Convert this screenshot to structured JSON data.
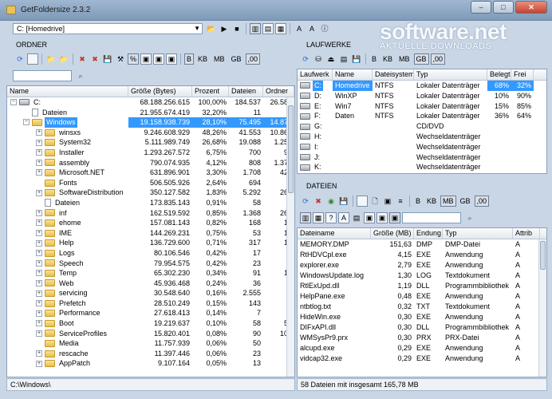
{
  "window": {
    "title": "GetFoldersize 2.3.2",
    "win_buttons": [
      "–",
      "□",
      "✕"
    ]
  },
  "watermark": {
    "main": "software.net",
    "sub": "AKTUELLE DOWNLOADS"
  },
  "toolbar": {
    "drive_path": "C: [Homedrive]",
    "unit_labels": [
      "B",
      "KB",
      "MB",
      "GB",
      ",00"
    ]
  },
  "left_panel": {
    "title": "ORDNER",
    "unit_labels": [
      "B",
      "KB",
      "MB",
      "GB",
      ",00"
    ],
    "columns": [
      "Name",
      "Größe (Bytes)",
      "Prozent",
      "Dateien",
      "Ordner"
    ],
    "rows": [
      {
        "name": "C:",
        "size": "68.188.256.615",
        "pct": "100,00%",
        "files": "184.537",
        "folders": "26.583",
        "level": 0,
        "kind": "drive",
        "exp": "−"
      },
      {
        "name": "Dateien",
        "size": "21.955.674.419",
        "pct": "32,20%",
        "files": "11",
        "folders": "",
        "level": 1,
        "kind": "file",
        "exp": ""
      },
      {
        "name": "Windows",
        "size": "19.158.938.739",
        "pct": "28,10%",
        "files": "75.495",
        "folders": "14.870",
        "level": 1,
        "kind": "folder",
        "exp": "−",
        "selected": true
      },
      {
        "name": "winsxs",
        "size": "9.246.608.929",
        "pct": "48,26%",
        "files": "41.553",
        "folders": "10.864",
        "level": 2,
        "kind": "folder",
        "exp": "+"
      },
      {
        "name": "System32",
        "size": "5.111.989.749",
        "pct": "26,68%",
        "files": "19.088",
        "folders": "1.250",
        "level": 2,
        "kind": "folder",
        "exp": "+"
      },
      {
        "name": "Installer",
        "size": "1.293.267.572",
        "pct": "6,75%",
        "files": "700",
        "folders": "90",
        "level": 2,
        "kind": "folder",
        "exp": "+"
      },
      {
        "name": "assembly",
        "size": "790.074.935",
        "pct": "4,12%",
        "files": "808",
        "folders": "1.372",
        "level": 2,
        "kind": "folder",
        "exp": "+"
      },
      {
        "name": "Microsoft.NET",
        "size": "631.896.901",
        "pct": "3,30%",
        "files": "1.708",
        "folders": "424",
        "level": 2,
        "kind": "folder",
        "exp": "+"
      },
      {
        "name": "Fonts",
        "size": "506.505.926",
        "pct": "2,64%",
        "files": "694",
        "folders": "0",
        "level": 2,
        "kind": "folder",
        "exp": ""
      },
      {
        "name": "SoftwareDistribution",
        "size": "350.127.582",
        "pct": "1,83%",
        "files": "5.292",
        "folders": "260",
        "level": 2,
        "kind": "folder",
        "exp": "+"
      },
      {
        "name": "Dateien",
        "size": "173.835.143",
        "pct": "0,91%",
        "files": "58",
        "folders": "",
        "level": 2,
        "kind": "file",
        "exp": ""
      },
      {
        "name": "inf",
        "size": "162.519.592",
        "pct": "0,85%",
        "files": "1.368",
        "folders": "268",
        "level": 2,
        "kind": "folder",
        "exp": "+"
      },
      {
        "name": "ehome",
        "size": "157.081.143",
        "pct": "0,82%",
        "files": "168",
        "folders": "17",
        "level": 2,
        "kind": "folder",
        "exp": "+"
      },
      {
        "name": "IME",
        "size": "144.269.231",
        "pct": "0,75%",
        "files": "53",
        "folders": "13",
        "level": 2,
        "kind": "folder",
        "exp": "+"
      },
      {
        "name": "Help",
        "size": "136.729.600",
        "pct": "0,71%",
        "files": "317",
        "folders": "13",
        "level": 2,
        "kind": "folder",
        "exp": "+"
      },
      {
        "name": "Logs",
        "size": "80.106.546",
        "pct": "0,42%",
        "files": "17",
        "folders": "3",
        "level": 2,
        "kind": "folder",
        "exp": "+"
      },
      {
        "name": "Speech",
        "size": "79.954.575",
        "pct": "0,42%",
        "files": "23",
        "folders": "7",
        "level": 2,
        "kind": "folder",
        "exp": "+"
      },
      {
        "name": "Temp",
        "size": "65.302.230",
        "pct": "0,34%",
        "files": "91",
        "folders": "13",
        "level": 2,
        "kind": "folder",
        "exp": "+"
      },
      {
        "name": "Web",
        "size": "45.936.468",
        "pct": "0,24%",
        "files": "36",
        "folders": "1",
        "level": 2,
        "kind": "folder",
        "exp": "+"
      },
      {
        "name": "servicing",
        "size": "30.548.640",
        "pct": "0,16%",
        "files": "2.555",
        "folders": "5",
        "level": 2,
        "kind": "folder",
        "exp": "+"
      },
      {
        "name": "Prefetch",
        "size": "28.510.249",
        "pct": "0,15%",
        "files": "143",
        "folders": "1",
        "level": 2,
        "kind": "folder",
        "exp": "+"
      },
      {
        "name": "Performance",
        "size": "27.618.413",
        "pct": "0,14%",
        "files": "7",
        "folders": "2",
        "level": 2,
        "kind": "folder",
        "exp": "+"
      },
      {
        "name": "Boot",
        "size": "19.219.637",
        "pct": "0,10%",
        "files": "58",
        "folders": "52",
        "level": 2,
        "kind": "folder",
        "exp": "+"
      },
      {
        "name": "ServiceProfiles",
        "size": "15.820.401",
        "pct": "0,08%",
        "files": "90",
        "folders": "104",
        "level": 2,
        "kind": "folder",
        "exp": "+"
      },
      {
        "name": "Media",
        "size": "11.757.939",
        "pct": "0,06%",
        "files": "50",
        "folders": "0",
        "level": 2,
        "kind": "folder",
        "exp": ""
      },
      {
        "name": "rescache",
        "size": "11.397.446",
        "pct": "0,06%",
        "files": "23",
        "folders": "2",
        "level": 2,
        "kind": "folder",
        "exp": "+"
      },
      {
        "name": "AppPatch",
        "size": "9.107.164",
        "pct": "0,05%",
        "files": "13",
        "folders": "2",
        "level": 2,
        "kind": "folder",
        "exp": "+"
      }
    ],
    "status": "C:\\Windows\\"
  },
  "drives_panel": {
    "title": "LAUFWERKE",
    "unit_labels": [
      "B",
      "KB",
      "MB",
      "GB",
      ",00"
    ],
    "columns": [
      "Laufwerk",
      "Name",
      "Dateisystem",
      "Typ",
      "Belegt",
      "Frei"
    ],
    "rows": [
      {
        "drive": "C:",
        "name": "Homedrive",
        "fs": "NTFS",
        "type": "Lokaler Datenträger",
        "used": "68%",
        "free": "32%",
        "selected": true
      },
      {
        "drive": "D:",
        "name": "WinXP",
        "fs": "NTFS",
        "type": "Lokaler Datenträger",
        "used": "10%",
        "free": "90%"
      },
      {
        "drive": "E:",
        "name": "Win7",
        "fs": "NTFS",
        "type": "Lokaler Datenträger",
        "used": "15%",
        "free": "85%"
      },
      {
        "drive": "F:",
        "name": "Daten",
        "fs": "NTFS",
        "type": "Lokaler Datenträger",
        "used": "36%",
        "free": "64%"
      },
      {
        "drive": "G:",
        "name": "",
        "fs": "",
        "type": "CD/DVD",
        "used": "",
        "free": ""
      },
      {
        "drive": "H:",
        "name": "",
        "fs": "",
        "type": "Wechseldatenträger",
        "used": "",
        "free": ""
      },
      {
        "drive": "I:",
        "name": "",
        "fs": "",
        "type": "Wechseldatenträger",
        "used": "",
        "free": ""
      },
      {
        "drive": "J:",
        "name": "",
        "fs": "",
        "type": "Wechseldatenträger",
        "used": "",
        "free": ""
      },
      {
        "drive": "K:",
        "name": "",
        "fs": "",
        "type": "Wechseldatenträger",
        "used": "",
        "free": ""
      }
    ]
  },
  "files_panel": {
    "title": "DATEIEN",
    "unit_labels": [
      "B",
      "KB",
      "MB",
      "GB",
      ",00"
    ],
    "columns": [
      "Dateiname",
      "Größe (MB)",
      "Endung",
      "Typ",
      "Attrib"
    ],
    "rows": [
      {
        "name": "MEMORY.DMP",
        "size": "151,63",
        "ext": "DMP",
        "type": "DMP-Datei",
        "attr": "A"
      },
      {
        "name": "RtHDVCpl.exe",
        "size": "4,15",
        "ext": "EXE",
        "type": "Anwendung",
        "attr": "A"
      },
      {
        "name": "explorer.exe",
        "size": "2,79",
        "ext": "EXE",
        "type": "Anwendung",
        "attr": "A"
      },
      {
        "name": "WindowsUpdate.log",
        "size": "1,30",
        "ext": "LOG",
        "type": "Textdokument",
        "attr": "A"
      },
      {
        "name": "RtlExUpd.dll",
        "size": "1,19",
        "ext": "DLL",
        "type": "Programmbibliothek",
        "attr": "A"
      },
      {
        "name": "HelpPane.exe",
        "size": "0,48",
        "ext": "EXE",
        "type": "Anwendung",
        "attr": "A"
      },
      {
        "name": "ntbtlog.txt",
        "size": "0,32",
        "ext": "TXT",
        "type": "Textdokument",
        "attr": "A"
      },
      {
        "name": "HideWin.exe",
        "size": "0,30",
        "ext": "EXE",
        "type": "Anwendung",
        "attr": "A"
      },
      {
        "name": "DIFxAPI.dll",
        "size": "0,30",
        "ext": "DLL",
        "type": "Programmbibliothek",
        "attr": "A"
      },
      {
        "name": "WMSysPr9.prx",
        "size": "0,30",
        "ext": "PRX",
        "type": "PRX-Datei",
        "attr": "A"
      },
      {
        "name": "alcupd.exe",
        "size": "0,29",
        "ext": "EXE",
        "type": "Anwendung",
        "attr": "A"
      },
      {
        "name": "vidcap32.exe",
        "size": "0,29",
        "ext": "EXE",
        "type": "Anwendung",
        "attr": "A"
      }
    ],
    "status": "58 Dateien mit insgesamt 165,78 MB"
  }
}
